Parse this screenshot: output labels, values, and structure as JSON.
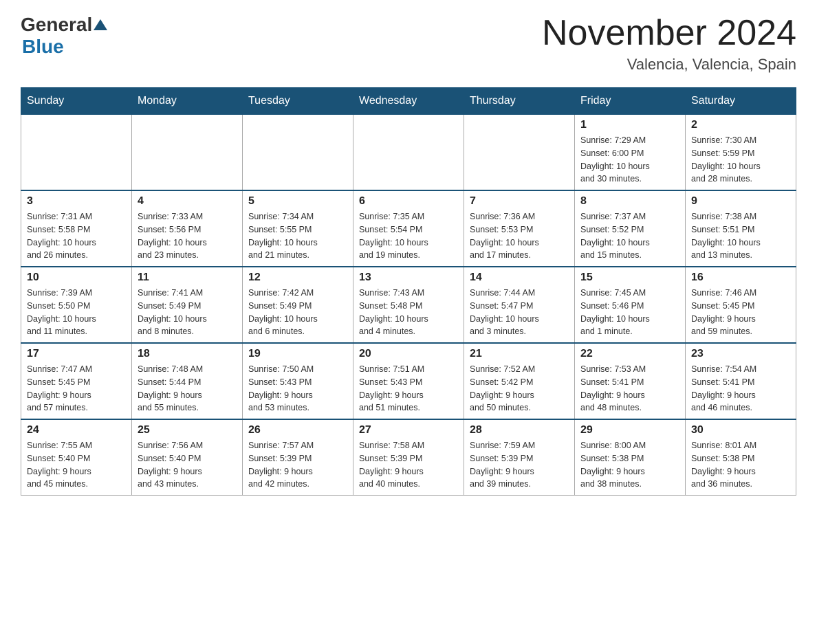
{
  "logo": {
    "general": "General",
    "blue": "Blue"
  },
  "title": "November 2024",
  "location": "Valencia, Valencia, Spain",
  "days_of_week": [
    "Sunday",
    "Monday",
    "Tuesday",
    "Wednesday",
    "Thursday",
    "Friday",
    "Saturday"
  ],
  "weeks": [
    [
      {
        "day": "",
        "info": ""
      },
      {
        "day": "",
        "info": ""
      },
      {
        "day": "",
        "info": ""
      },
      {
        "day": "",
        "info": ""
      },
      {
        "day": "",
        "info": ""
      },
      {
        "day": "1",
        "info": "Sunrise: 7:29 AM\nSunset: 6:00 PM\nDaylight: 10 hours\nand 30 minutes."
      },
      {
        "day": "2",
        "info": "Sunrise: 7:30 AM\nSunset: 5:59 PM\nDaylight: 10 hours\nand 28 minutes."
      }
    ],
    [
      {
        "day": "3",
        "info": "Sunrise: 7:31 AM\nSunset: 5:58 PM\nDaylight: 10 hours\nand 26 minutes."
      },
      {
        "day": "4",
        "info": "Sunrise: 7:33 AM\nSunset: 5:56 PM\nDaylight: 10 hours\nand 23 minutes."
      },
      {
        "day": "5",
        "info": "Sunrise: 7:34 AM\nSunset: 5:55 PM\nDaylight: 10 hours\nand 21 minutes."
      },
      {
        "day": "6",
        "info": "Sunrise: 7:35 AM\nSunset: 5:54 PM\nDaylight: 10 hours\nand 19 minutes."
      },
      {
        "day": "7",
        "info": "Sunrise: 7:36 AM\nSunset: 5:53 PM\nDaylight: 10 hours\nand 17 minutes."
      },
      {
        "day": "8",
        "info": "Sunrise: 7:37 AM\nSunset: 5:52 PM\nDaylight: 10 hours\nand 15 minutes."
      },
      {
        "day": "9",
        "info": "Sunrise: 7:38 AM\nSunset: 5:51 PM\nDaylight: 10 hours\nand 13 minutes."
      }
    ],
    [
      {
        "day": "10",
        "info": "Sunrise: 7:39 AM\nSunset: 5:50 PM\nDaylight: 10 hours\nand 11 minutes."
      },
      {
        "day": "11",
        "info": "Sunrise: 7:41 AM\nSunset: 5:49 PM\nDaylight: 10 hours\nand 8 minutes."
      },
      {
        "day": "12",
        "info": "Sunrise: 7:42 AM\nSunset: 5:49 PM\nDaylight: 10 hours\nand 6 minutes."
      },
      {
        "day": "13",
        "info": "Sunrise: 7:43 AM\nSunset: 5:48 PM\nDaylight: 10 hours\nand 4 minutes."
      },
      {
        "day": "14",
        "info": "Sunrise: 7:44 AM\nSunset: 5:47 PM\nDaylight: 10 hours\nand 3 minutes."
      },
      {
        "day": "15",
        "info": "Sunrise: 7:45 AM\nSunset: 5:46 PM\nDaylight: 10 hours\nand 1 minute."
      },
      {
        "day": "16",
        "info": "Sunrise: 7:46 AM\nSunset: 5:45 PM\nDaylight: 9 hours\nand 59 minutes."
      }
    ],
    [
      {
        "day": "17",
        "info": "Sunrise: 7:47 AM\nSunset: 5:45 PM\nDaylight: 9 hours\nand 57 minutes."
      },
      {
        "day": "18",
        "info": "Sunrise: 7:48 AM\nSunset: 5:44 PM\nDaylight: 9 hours\nand 55 minutes."
      },
      {
        "day": "19",
        "info": "Sunrise: 7:50 AM\nSunset: 5:43 PM\nDaylight: 9 hours\nand 53 minutes."
      },
      {
        "day": "20",
        "info": "Sunrise: 7:51 AM\nSunset: 5:43 PM\nDaylight: 9 hours\nand 51 minutes."
      },
      {
        "day": "21",
        "info": "Sunrise: 7:52 AM\nSunset: 5:42 PM\nDaylight: 9 hours\nand 50 minutes."
      },
      {
        "day": "22",
        "info": "Sunrise: 7:53 AM\nSunset: 5:41 PM\nDaylight: 9 hours\nand 48 minutes."
      },
      {
        "day": "23",
        "info": "Sunrise: 7:54 AM\nSunset: 5:41 PM\nDaylight: 9 hours\nand 46 minutes."
      }
    ],
    [
      {
        "day": "24",
        "info": "Sunrise: 7:55 AM\nSunset: 5:40 PM\nDaylight: 9 hours\nand 45 minutes."
      },
      {
        "day": "25",
        "info": "Sunrise: 7:56 AM\nSunset: 5:40 PM\nDaylight: 9 hours\nand 43 minutes."
      },
      {
        "day": "26",
        "info": "Sunrise: 7:57 AM\nSunset: 5:39 PM\nDaylight: 9 hours\nand 42 minutes."
      },
      {
        "day": "27",
        "info": "Sunrise: 7:58 AM\nSunset: 5:39 PM\nDaylight: 9 hours\nand 40 minutes."
      },
      {
        "day": "28",
        "info": "Sunrise: 7:59 AM\nSunset: 5:39 PM\nDaylight: 9 hours\nand 39 minutes."
      },
      {
        "day": "29",
        "info": "Sunrise: 8:00 AM\nSunset: 5:38 PM\nDaylight: 9 hours\nand 38 minutes."
      },
      {
        "day": "30",
        "info": "Sunrise: 8:01 AM\nSunset: 5:38 PM\nDaylight: 9 hours\nand 36 minutes."
      }
    ]
  ]
}
